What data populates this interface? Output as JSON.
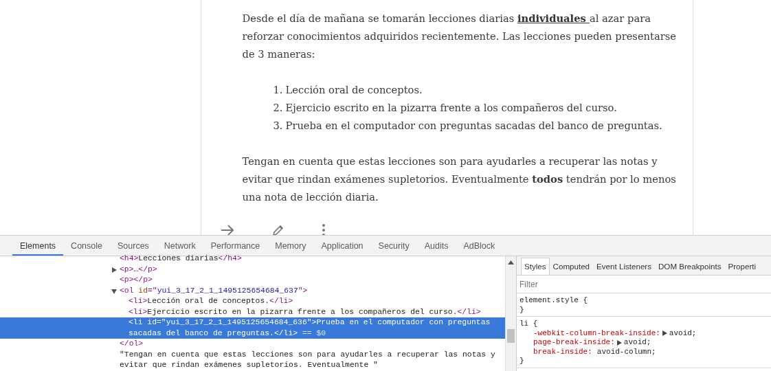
{
  "article": {
    "intro": [
      {
        "kind": "text",
        "text": "Desde el día de mañana se tomarán lecciones diarias "
      },
      {
        "kind": "link",
        "text": "individuales "
      },
      {
        "kind": "text",
        "text": "al azar para reforzar conocimientos adquiridos recientemente. Las lecciones pueden presentarse de 3 maneras:"
      }
    ],
    "list": [
      {
        "marker": "1.",
        "text": "Lección oral de conceptos."
      },
      {
        "marker": "2.",
        "text": "Ejercicio escrito en la pizarra frente a los compañeros del curso."
      },
      {
        "marker": "3.",
        "text": "Prueba en el computador con preguntas sacadas del banco de preguntas."
      }
    ],
    "closing": "Tengan en cuenta que estas lecciones son para ayudarles a recuperar las notas y evitar que rindan exámenes supletorios. Eventualmente **todos** tendrán por lo menos una nota de lección diaria."
  },
  "devtools": {
    "tabs": [
      {
        "label": "Elements",
        "selected": true
      },
      {
        "label": "Console",
        "selected": false
      },
      {
        "label": "Sources",
        "selected": false
      },
      {
        "label": "Network",
        "selected": false
      },
      {
        "label": "Performance",
        "selected": false
      },
      {
        "label": "Memory",
        "selected": false
      },
      {
        "label": "Application",
        "selected": false
      },
      {
        "label": "Security",
        "selected": false
      },
      {
        "label": "Audits",
        "selected": false
      },
      {
        "label": "AdBlock",
        "selected": false
      }
    ],
    "dom": [
      {
        "selected": false,
        "code": [
          {
            "kind": "tag",
            "text": "<h4>"
          },
          {
            "kind": "text",
            "text": "Lecciones diarias"
          },
          {
            "kind": "tag",
            "text": "</h4>"
          }
        ]
      },
      {
        "selected": false,
        "expanded": false,
        "code": [
          {
            "kind": "tag",
            "text": "<p>"
          },
          {
            "kind": "text",
            "text": "…"
          },
          {
            "kind": "tag",
            "text": "</p>"
          }
        ]
      },
      {
        "selected": false,
        "code": [
          {
            "kind": "tag",
            "text": "<p></p>"
          }
        ]
      },
      {
        "selected": false,
        "expanded": true,
        "code": [
          {
            "kind": "tag",
            "text": "<ol"
          },
          {
            "kind": "attr",
            "text": " id"
          },
          {
            "kind": "tag",
            "text": "=\""
          },
          {
            "kind": "value",
            "text": "yui_3_17_2_1_1495125654684_637"
          },
          {
            "kind": "tag",
            "text": "\">"
          }
        ],
        "closing": [
          {
            "kind": "tag",
            "text": "</ol>"
          }
        ],
        "children": [
          {
            "selected": false,
            "code": [
              {
                "kind": "tag",
                "text": "<li>"
              },
              {
                "kind": "text",
                "text": "Lección oral de conceptos."
              },
              {
                "kind": "tag",
                "text": "</li>"
              }
            ]
          },
          {
            "selected": false,
            "code": [
              {
                "kind": "tag",
                "text": "<li>"
              },
              {
                "kind": "text",
                "text": "Ejercicio escrito en la pizarra frente a los compañeros del curso."
              },
              {
                "kind": "tag",
                "text": "</li>"
              }
            ]
          },
          {
            "selected": true,
            "code": [
              {
                "kind": "tag",
                "text": "<li"
              },
              {
                "kind": "attr",
                "text": " id"
              },
              {
                "kind": "tag",
                "text": "=\""
              },
              {
                "kind": "value",
                "text": "yui_3_17_2_1_1495125654684_636"
              },
              {
                "kind": "tag",
                "text": "\">"
              },
              {
                "kind": "text",
                "text": "Prueba en el computador con preguntas sacadas del banco de preguntas."
              },
              {
                "kind": "tag",
                "text": "</li>"
              },
              {
                "kind": "note",
                "text": " == $0"
              }
            ]
          }
        ]
      },
      {
        "selected": false,
        "code": [
          {
            "kind": "text",
            "text": "\"Tengan en cuenta que estas lecciones son para ayudarles a recuperar las notas y evitar que rindan exámenes supletorios. Eventualmente \""
          }
        ]
      }
    ],
    "side_tabs": [
      {
        "label": "Styles",
        "selected": true
      },
      {
        "label": "Computed",
        "selected": false
      },
      {
        "label": "Event Listeners",
        "selected": false
      },
      {
        "label": "DOM Breakpoints",
        "selected": false
      },
      {
        "label": "Properti",
        "selected": false
      }
    ],
    "filter": {
      "placeholder": "Filter"
    },
    "rules": [
      {
        "selector": "element.style {",
        "close": "}"
      },
      {
        "selector": "li {",
        "close": "}",
        "properties": [
          {
            "name": "-webkit-column-break-inside:",
            "value": "avoid;",
            "expandable": true
          },
          {
            "name": "page-break-inside:",
            "value": "avoid;",
            "expandable": true
          },
          {
            "name": "break-inside:",
            "value": "avoid-column;",
            "expandable": false
          }
        ]
      }
    ]
  }
}
